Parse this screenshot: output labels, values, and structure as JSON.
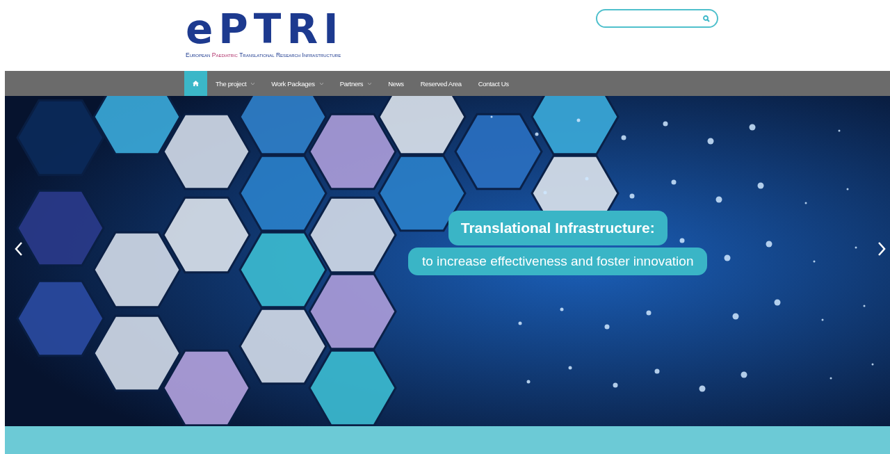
{
  "logo": {
    "wordmark": "ePTRI",
    "tagline": [
      {
        "text": "European",
        "highlighted": false
      },
      {
        "text": "Paediatric",
        "highlighted": true
      },
      {
        "text": "Translational",
        "highlighted": false
      },
      {
        "text": "Research",
        "highlighted": false
      },
      {
        "text": "Infrastructure",
        "highlighted": false
      }
    ]
  },
  "nav": [
    {
      "kind": "home",
      "selected": true
    },
    {
      "kind": "link",
      "label": "The project",
      "dropdown": true,
      "selected": false
    },
    {
      "kind": "link",
      "label": "Work Packages",
      "dropdown": true,
      "selected": false
    },
    {
      "kind": "link",
      "label": "Partners",
      "dropdown": true,
      "selected": false
    },
    {
      "kind": "link",
      "label": "News",
      "dropdown": false,
      "selected": false
    },
    {
      "kind": "link",
      "label": "Reserved Area",
      "dropdown": false,
      "selected": false
    },
    {
      "kind": "link",
      "label": "Contact Us",
      "dropdown": false,
      "selected": false
    }
  ],
  "slide": {
    "title": "Translational Infrastructure:",
    "subtitle": "to increase effectiveness and foster innovation"
  }
}
